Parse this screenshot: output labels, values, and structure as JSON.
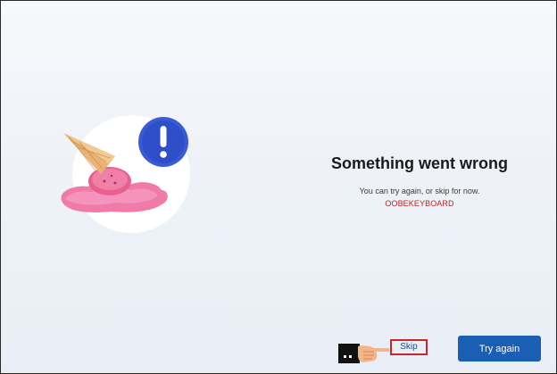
{
  "dialog": {
    "title": "Something went wrong",
    "subtitle": "You can try again, or skip for now.",
    "error_code": "OOBEKEYBOARD"
  },
  "actions": {
    "skip_label": "Skip",
    "try_again_label": "Try again"
  },
  "illustration": {
    "name": "melted-ice-cream-illustration",
    "badge_icon": "exclamation-icon"
  },
  "annotation": {
    "pointer_icon": "pointing-hand-icon",
    "highlight_color": "#c8262b"
  },
  "colors": {
    "primary_button": "#1a5fb4",
    "error_code": "#b3262b",
    "badge": "#3b5bd6"
  }
}
